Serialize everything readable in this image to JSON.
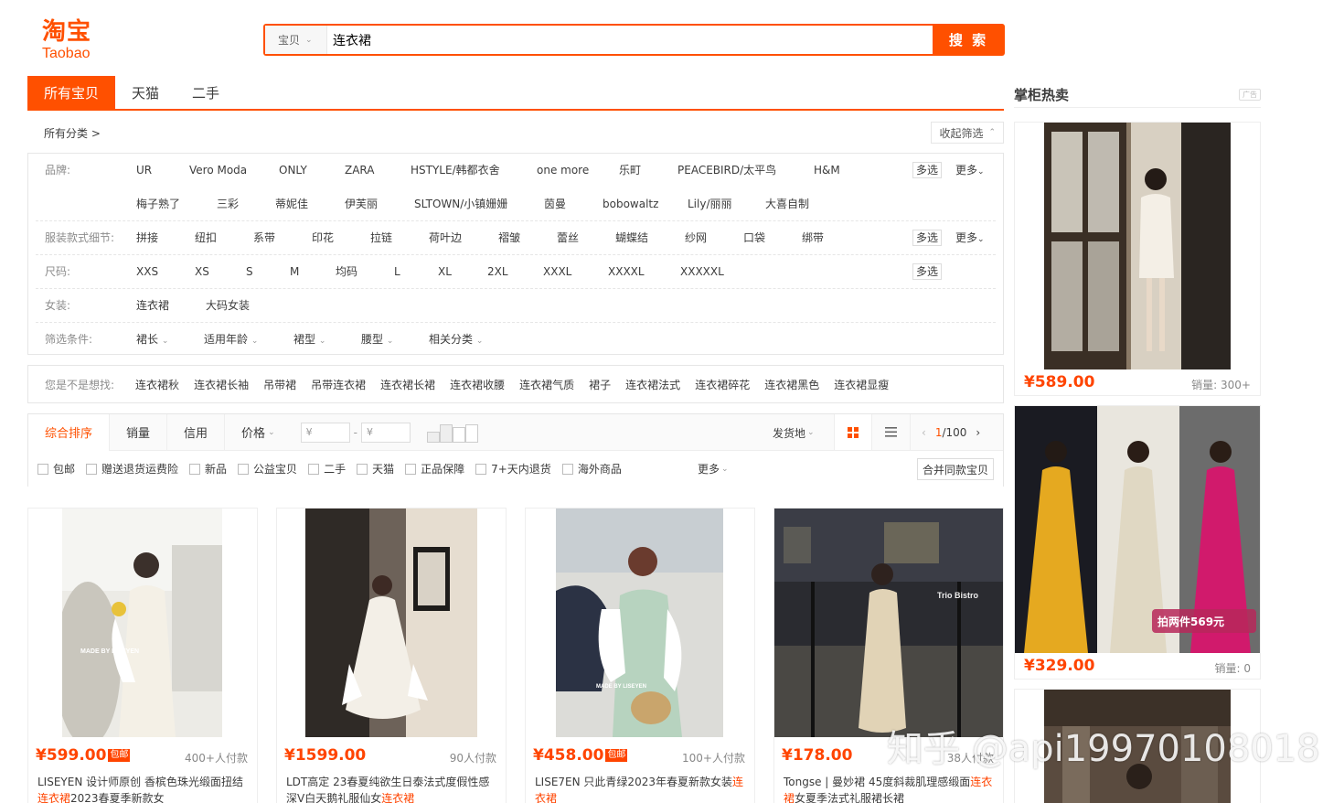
{
  "logo": {
    "zh": "淘宝",
    "en": "Taobao"
  },
  "search": {
    "type": "宝贝",
    "value": "连衣裙",
    "button": "搜 索"
  },
  "tabs": [
    "所有宝贝",
    "天猫",
    "二手"
  ],
  "side": {
    "title": "掌柜热卖",
    "ad": "广告"
  },
  "category": {
    "crumb": "所有分类 >",
    "collapse": "收起筛选"
  },
  "filters": {
    "brand": {
      "label": "品牌:",
      "row1": [
        "UR",
        "Vero Moda",
        "ONLY",
        "ZARA",
        "HSTYLE/韩都衣舍",
        "one more",
        "乐町",
        "PEACEBIRD/太平鸟",
        "H&M"
      ],
      "row2": [
        "梅子熟了",
        "三彩",
        "蒂妮佳",
        "伊芙丽",
        "SLTOWN/小镇姗姗",
        "茵曼",
        "bobowaltz",
        "Lily/丽丽",
        "大喜自制"
      ],
      "multi": "多选",
      "more": "更多"
    },
    "detail": {
      "label": "服装款式细节:",
      "items": [
        "拼接",
        "纽扣",
        "系带",
        "印花",
        "拉链",
        "荷叶边",
        "褶皱",
        "蕾丝",
        "蝴蝶结",
        "纱网",
        "口袋",
        "绑带"
      ],
      "multi": "多选",
      "more": "更多"
    },
    "size": {
      "label": "尺码:",
      "items": [
        "XXS",
        "XS",
        "S",
        "M",
        "均码",
        "L",
        "XL",
        "2XL",
        "XXXL",
        "XXXXL",
        "XXXXXL"
      ],
      "multi": "多选"
    },
    "women": {
      "label": "女装:",
      "items": [
        "连衣裙",
        "大码女装"
      ]
    },
    "conditions": {
      "label": "筛选条件:",
      "items": [
        "裙长",
        "适用年龄",
        "裙型",
        "腰型",
        "相关分类"
      ]
    }
  },
  "suggest": {
    "label": "您是不是想找:",
    "items": [
      "连衣裙秋",
      "连衣裙长袖",
      "吊带裙",
      "吊带连衣裙",
      "连衣裙长裙",
      "连衣裙收腰",
      "连衣裙气质",
      "裙子",
      "连衣裙法式",
      "连衣裙碎花",
      "连衣裙黑色",
      "连衣裙显瘦"
    ]
  },
  "sort": {
    "items": [
      "综合排序",
      "销量",
      "信用",
      "价格"
    ],
    "price_from": "¥",
    "price_to": "¥",
    "dash": "-",
    "ship_from": "发货地",
    "page": "1",
    "total": "/100"
  },
  "checks": {
    "items": [
      "包邮",
      "赠送退货运费险",
      "新品",
      "公益宝贝",
      "二手",
      "天猫",
      "正品保障",
      "7+天内退货",
      "海外商品"
    ],
    "more": "更多",
    "merge": "合并同款宝贝"
  },
  "products": [
    {
      "price": "¥599.00",
      "free": "包邮",
      "paid": "400+人付款",
      "title_a": "LISEYEN 设计师原创 香槟色珠光缎面扭结",
      "title_hl": "连衣裙",
      "title_b": "2023春夏季新款女"
    },
    {
      "price": "¥1599.00",
      "free": "",
      "paid": "90人付款",
      "title_a": "LDT高定 23春夏纯欲生日泰法式度假性感深V白天鹅礼服仙女",
      "title_hl": "连衣裙",
      "title_b": ""
    },
    {
      "price": "¥458.00",
      "free": "包邮",
      "paid": "100+人付款",
      "title_a": "LISE7EN 只此青绿2023年春夏新款女装",
      "title_hl": "连衣裙",
      "title_b": ""
    },
    {
      "price": "¥178.00",
      "free": "",
      "paid": "38人付款",
      "title_a": "Tongse | 曼妙裙 45度斜裁肌理感缎面",
      "title_hl": "连衣裙",
      "title_b": "女夏季法式礼服裙长裙"
    }
  ],
  "side_products": [
    {
      "price": "¥589.00",
      "sales": "销量: 300+"
    },
    {
      "price": "¥329.00",
      "sales": "销量: 0",
      "promo": "拍两件569元"
    }
  ],
  "watermark": "知乎 @api19970108018",
  "colors": {
    "accent": "#ff5000",
    "price": "#ff4400"
  }
}
